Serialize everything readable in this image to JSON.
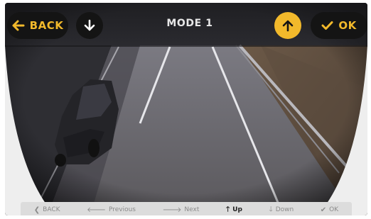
{
  "header": {
    "back_label": "BACK",
    "title": "MODE 1",
    "ok_label": "OK"
  },
  "footer": {
    "items": [
      {
        "label": "BACK",
        "icon": "chevron-left-icon",
        "active": false
      },
      {
        "label": "Previous",
        "icon": "arrow-left-icon",
        "active": false
      },
      {
        "label": "Next",
        "icon": "arrow-right-icon",
        "active": false
      },
      {
        "label": "Up",
        "icon": "arrow-up-icon",
        "active": true
      },
      {
        "label": "Down",
        "icon": "arrow-down-icon",
        "active": false
      },
      {
        "label": "OK",
        "icon": "check-icon",
        "active": false
      }
    ]
  },
  "colors": {
    "accent": "#f2b92b",
    "pill_background": "#141414",
    "footer_background": "#dcdcdc"
  }
}
